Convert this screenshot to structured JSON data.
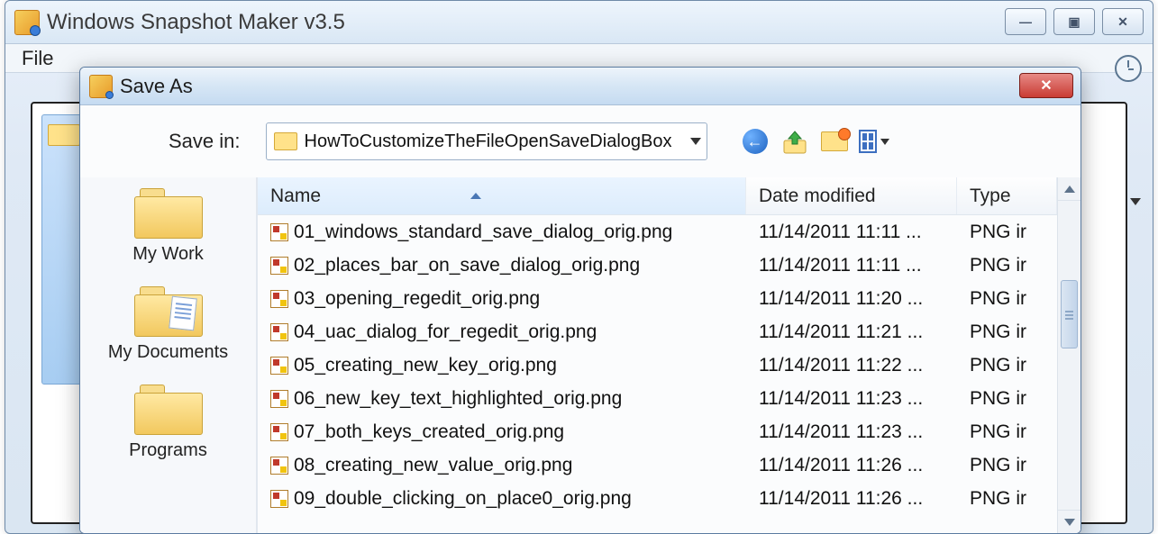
{
  "main_window": {
    "title": "Windows Snapshot Maker v3.5",
    "menu_file": "File"
  },
  "dialog": {
    "title": "Save As",
    "save_in_label": "Save in:",
    "save_in_value": "HowToCustomizeTheFileOpenSaveDialogBox",
    "places": [
      {
        "label": "My Work"
      },
      {
        "label": "My Documents"
      },
      {
        "label": "Programs"
      }
    ],
    "columns": {
      "name": "Name",
      "date": "Date modified",
      "type": "Type"
    },
    "files": [
      {
        "name": "01_windows_standard_save_dialog_orig.png",
        "date": "11/14/2011 11:11 ...",
        "type": "PNG ir"
      },
      {
        "name": "02_places_bar_on_save_dialog_orig.png",
        "date": "11/14/2011 11:11 ...",
        "type": "PNG ir"
      },
      {
        "name": "03_opening_regedit_orig.png",
        "date": "11/14/2011 11:20 ...",
        "type": "PNG ir"
      },
      {
        "name": "04_uac_dialog_for_regedit_orig.png",
        "date": "11/14/2011 11:21 ...",
        "type": "PNG ir"
      },
      {
        "name": "05_creating_new_key_orig.png",
        "date": "11/14/2011 11:22 ...",
        "type": "PNG ir"
      },
      {
        "name": "06_new_key_text_highlighted_orig.png",
        "date": "11/14/2011 11:23 ...",
        "type": "PNG ir"
      },
      {
        "name": "07_both_keys_created_orig.png",
        "date": "11/14/2011 11:23 ...",
        "type": "PNG ir"
      },
      {
        "name": "08_creating_new_value_orig.png",
        "date": "11/14/2011 11:26 ...",
        "type": "PNG ir"
      },
      {
        "name": "09_double_clicking_on_place0_orig.png",
        "date": "11/14/2011 11:26 ...",
        "type": "PNG ir"
      }
    ]
  }
}
